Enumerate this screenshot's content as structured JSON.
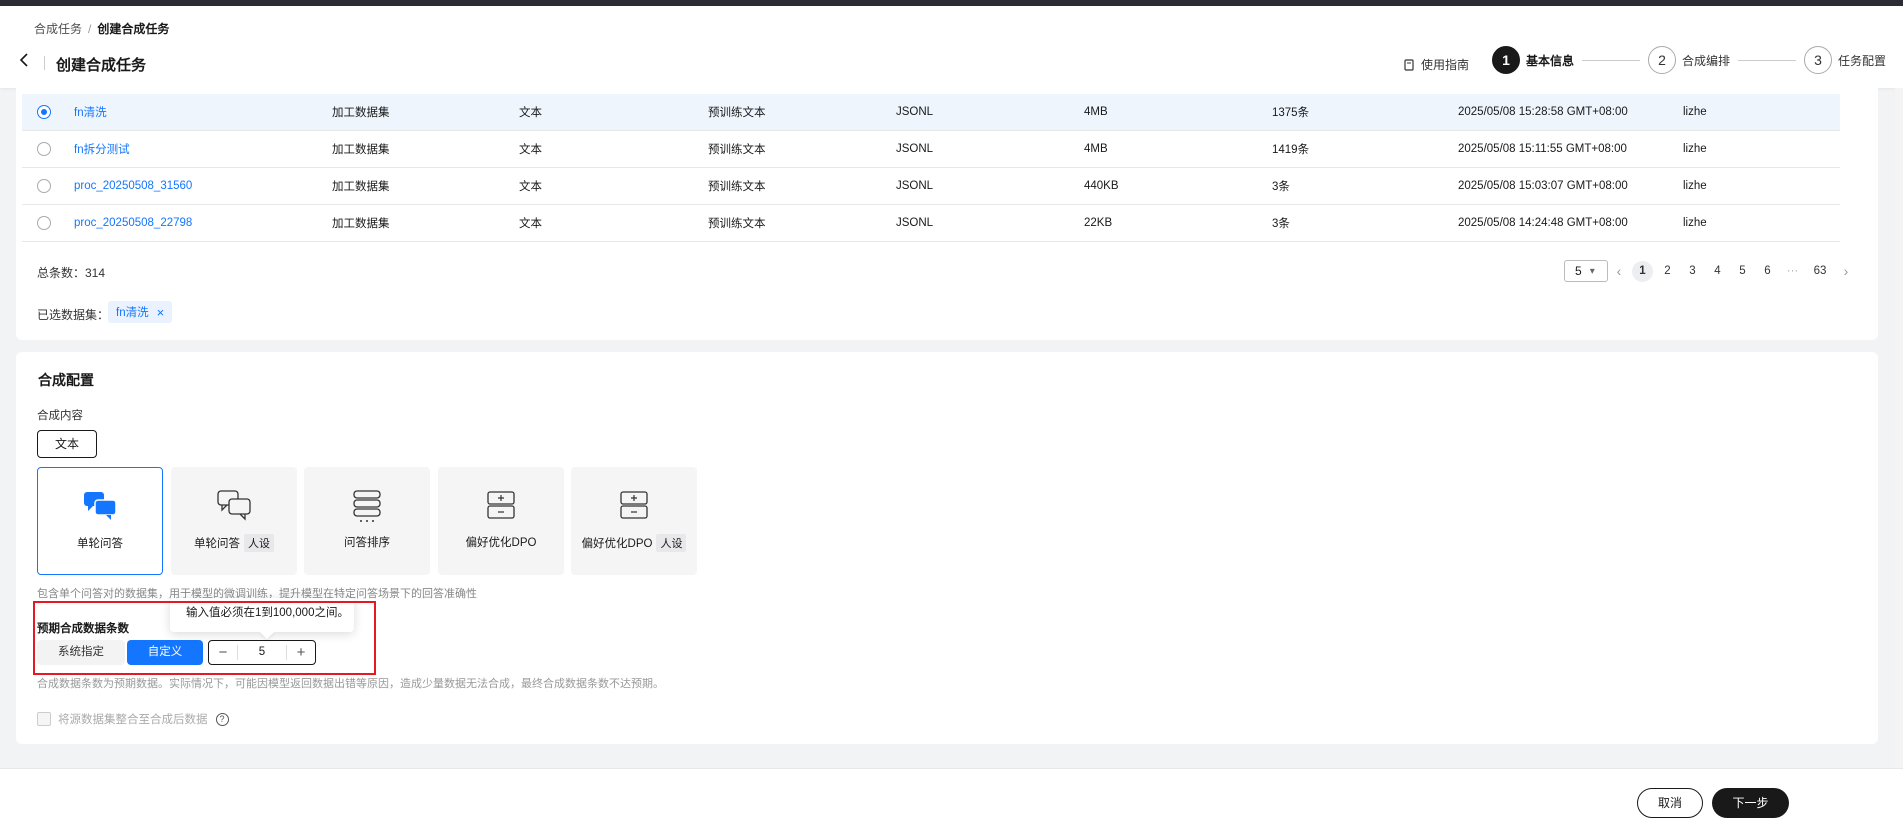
{
  "breadcrumb": {
    "parent": "合成任务",
    "current": "创建合成任务"
  },
  "page_title": "创建合成任务",
  "guide_label": "使用指南",
  "steps": [
    {
      "num": "1",
      "label": "基本信息"
    },
    {
      "num": "2",
      "label": "合成编排"
    },
    {
      "num": "3",
      "label": "任务配置"
    }
  ],
  "table_rows": [
    {
      "name": "fn清洗",
      "type": "加工数据集",
      "modality": "文本",
      "usage": "预训练文本",
      "format": "JSONL",
      "size": "4MB",
      "count": "1375条",
      "time": "2025/05/08 15:28:58 GMT+08:00",
      "creator": "lizhe",
      "selected": true
    },
    {
      "name": "fn拆分测试",
      "type": "加工数据集",
      "modality": "文本",
      "usage": "预训练文本",
      "format": "JSONL",
      "size": "4MB",
      "count": "1419条",
      "time": "2025/05/08 15:11:55 GMT+08:00",
      "creator": "lizhe",
      "selected": false
    },
    {
      "name": "proc_20250508_31560",
      "type": "加工数据集",
      "modality": "文本",
      "usage": "预训练文本",
      "format": "JSONL",
      "size": "440KB",
      "count": "3条",
      "time": "2025/05/08 15:03:07 GMT+08:00",
      "creator": "lizhe",
      "selected": false
    },
    {
      "name": "proc_20250508_22798",
      "type": "加工数据集",
      "modality": "文本",
      "usage": "预训练文本",
      "format": "JSONL",
      "size": "22KB",
      "count": "3条",
      "time": "2025/05/08 14:24:48 GMT+08:00",
      "creator": "lizhe",
      "selected": false
    }
  ],
  "total_label": "总条数：314",
  "pagination": {
    "page_size": "5",
    "pages": [
      "1",
      "2",
      "3",
      "4",
      "5",
      "6",
      "···",
      "63"
    ],
    "current": "1"
  },
  "selected_datasets_label": "已选数据集：",
  "selected_tag": "fn清洗",
  "config": {
    "title": "合成配置",
    "content_label": "合成内容",
    "content_type": "文本",
    "task_types": [
      {
        "label": "单轮问答",
        "badge": "",
        "icon": "chat-bubbles-filled-icon"
      },
      {
        "label": "单轮问答",
        "badge": "人设",
        "icon": "chat-bubbles-outline-icon"
      },
      {
        "label": "问答排序",
        "badge": "",
        "icon": "ranking-list-icon"
      },
      {
        "label": "偏好优化DPO",
        "badge": "",
        "icon": "dpo-icon"
      },
      {
        "label": "偏好优化DPO",
        "badge": "人设",
        "icon": "dpo-icon"
      }
    ],
    "description": "包含单个问答对的数据集，用于模型的微调训练，提升模型在特定问答场景下的回答准确性",
    "tooltip": "输入值必须在1到100,000之间。",
    "expected_count_label": "预期合成数据条数",
    "seg_system": "系统指定",
    "seg_custom": "自定义",
    "stepper_value": "5",
    "note": "合成数据条数为预期数据。实际情况下，可能因模型返回数据出错等原因，造成少量数据无法合成，最终合成数据条数不达预期。",
    "checkbox_label": "将源数据集整合至合成后数据"
  },
  "footer": {
    "cancel": "取消",
    "next": "下一步"
  },
  "colors": {
    "accent": "#1476ff",
    "dark": "#191919",
    "highlight": "#e5191f"
  }
}
